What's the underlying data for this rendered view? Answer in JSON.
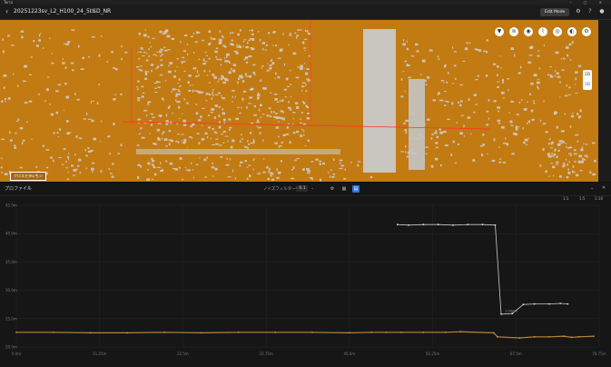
{
  "titlebar": {
    "app": "Terra"
  },
  "header": {
    "back_icon": "arrow-left-icon",
    "filename": "20251223sv_L2_H100_24_5LSD_NR",
    "edit_mode_label": "Edit Mode",
    "icons": [
      "gear-icon",
      "help-icon",
      "user-icon"
    ]
  },
  "map": {
    "tools": [
      "filter-icon",
      "layers-icon",
      "point-icon",
      "profile-icon",
      "measure-icon",
      "camera-icon",
      "settings-icon"
    ],
    "view_2d": "2D",
    "view_3d": "3D",
    "selection_label": "クロスセクション"
  },
  "panel": {
    "title": "プロファイル",
    "filter_label": "ノイズフィルター強度",
    "filter_value": "0.1",
    "scale_buttons": [
      "1:1",
      "1:5",
      "1:10"
    ]
  },
  "colors": {
    "map_bg": "#c27a12",
    "ground_series": "#d08f3a",
    "top_series": "#dddddd",
    "accent": "#2a74e0"
  },
  "chart_data": {
    "type": "scatter",
    "title": "",
    "xlabel": "",
    "ylabel": "",
    "x_ticks": [
      "0.0m",
      "11.25m",
      "22.5m",
      "33.75m",
      "45.0m",
      "56.25m",
      "67.5m",
      "78.75m"
    ],
    "y_ticks": [
      "20.0m",
      "25.0m",
      "30.0m",
      "35.0m",
      "40.0m",
      "45.0m"
    ],
    "xlim": [
      0,
      78.75
    ],
    "ylim": [
      20,
      45
    ],
    "annotation": "1.000m",
    "series": [
      {
        "x": [
          0,
          5,
          10,
          15,
          20,
          25,
          30,
          35,
          40,
          45,
          48,
          50,
          52,
          55,
          58,
          60,
          64.5,
          65,
          68,
          70,
          72,
          74,
          75,
          76,
          78
        ],
        "y": [
          22.6,
          22.6,
          22.5,
          22.5,
          22.6,
          22.5,
          22.6,
          22.6,
          22.6,
          22.5,
          22.6,
          22.6,
          22.6,
          22.6,
          22.6,
          22.7,
          22.5,
          21.8,
          21.6,
          21.8,
          21.8,
          21.9,
          21.7,
          21.8,
          21.9
        ]
      },
      {
        "x": [
          51.5,
          53,
          55,
          57,
          59,
          61,
          63,
          64.7,
          65.5,
          67,
          68.5,
          70,
          72,
          73.5,
          74.5
        ],
        "y": [
          41.6,
          41.5,
          41.6,
          41.6,
          41.5,
          41.6,
          41.6,
          41.5,
          25.8,
          25.9,
          27.5,
          27.6,
          27.6,
          27.7,
          27.6
        ]
      }
    ]
  }
}
